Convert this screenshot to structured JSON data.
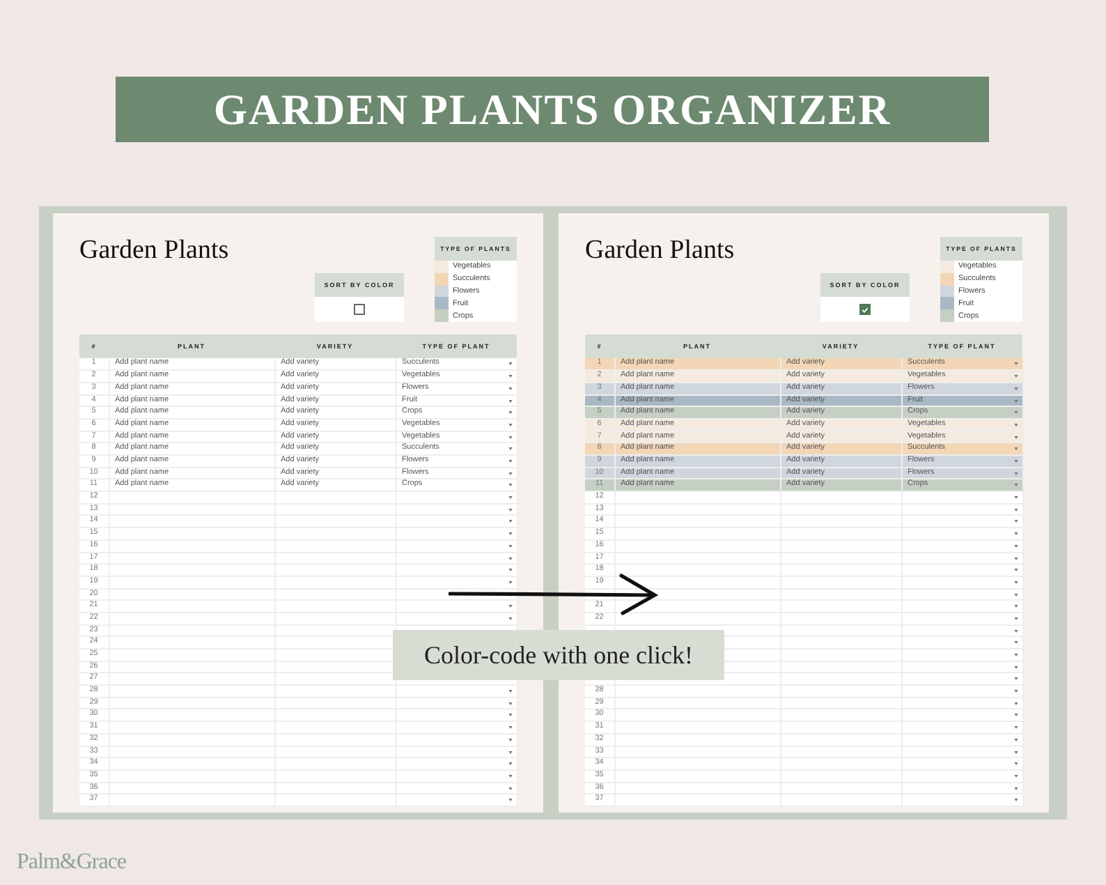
{
  "banner": "GARDEN PLANTS ORGANIZER",
  "sheets": [
    {
      "title": "Garden Plants",
      "sort": {
        "label": "SORT BY COLOR",
        "checked": false
      },
      "legend": {
        "title": "TYPE OF PLANTS",
        "items": [
          {
            "label": "Vegetables",
            "color": "#f4eadf"
          },
          {
            "label": "Succulents",
            "color": "#f2d6b6"
          },
          {
            "label": "Flowers",
            "color": "#cfd6dd"
          },
          {
            "label": "Fruit",
            "color": "#a9b8c5"
          },
          {
            "label": "Crops",
            "color": "#c5cfc4"
          }
        ]
      },
      "columns": [
        "#",
        "PLANT",
        "VARIETY",
        "TYPE OF PLANT"
      ],
      "rows": [
        {
          "num": "1",
          "plant": "Add plant name",
          "variety": "Add variety",
          "type": "Succulents"
        },
        {
          "num": "2",
          "plant": "Add plant name",
          "variety": "Add variety",
          "type": "Vegetables"
        },
        {
          "num": "3",
          "plant": "Add plant name",
          "variety": "Add variety",
          "type": "Flowers"
        },
        {
          "num": "4",
          "plant": "Add plant name",
          "variety": "Add variety",
          "type": "Fruit"
        },
        {
          "num": "5",
          "plant": "Add plant name",
          "variety": "Add variety",
          "type": "Crops"
        },
        {
          "num": "6",
          "plant": "Add plant name",
          "variety": "Add variety",
          "type": "Vegetables"
        },
        {
          "num": "7",
          "plant": "Add plant name",
          "variety": "Add variety",
          "type": "Vegetables"
        },
        {
          "num": "8",
          "plant": "Add plant name",
          "variety": "Add variety",
          "type": "Succulents"
        },
        {
          "num": "9",
          "plant": "Add plant name",
          "variety": "Add variety",
          "type": "Flowers"
        },
        {
          "num": "10",
          "plant": "Add plant name",
          "variety": "Add variety",
          "type": "Flowers"
        },
        {
          "num": "11",
          "plant": "Add plant name",
          "variety": "Add variety",
          "type": "Crops"
        },
        {
          "num": "12"
        },
        {
          "num": "13"
        },
        {
          "num": "14"
        },
        {
          "num": "15"
        },
        {
          "num": "16"
        },
        {
          "num": "17"
        },
        {
          "num": "18"
        },
        {
          "num": "19"
        },
        {
          "num": "20"
        },
        {
          "num": "21"
        },
        {
          "num": "22"
        },
        {
          "num": "23"
        },
        {
          "num": "24"
        },
        {
          "num": "25"
        },
        {
          "num": "26"
        },
        {
          "num": "27"
        },
        {
          "num": "28"
        },
        {
          "num": "29"
        },
        {
          "num": "30"
        },
        {
          "num": "31"
        },
        {
          "num": "32"
        },
        {
          "num": "33"
        },
        {
          "num": "34"
        },
        {
          "num": "35"
        },
        {
          "num": "36"
        },
        {
          "num": "37"
        }
      ]
    },
    {
      "title": "Garden Plants",
      "sort": {
        "label": "SORT BY COLOR",
        "checked": true
      },
      "legend": {
        "title": "TYPE OF PLANTS",
        "items": [
          {
            "label": "Vegetables",
            "color": "#f4eadf"
          },
          {
            "label": "Succulents",
            "color": "#f2d6b6"
          },
          {
            "label": "Flowers",
            "color": "#cfd6dd"
          },
          {
            "label": "Fruit",
            "color": "#a9b8c5"
          },
          {
            "label": "Crops",
            "color": "#c5cfc4"
          }
        ]
      },
      "columns": [
        "#",
        "PLANT",
        "VARIETY",
        "TYPE OF PLANT"
      ],
      "rows": [
        {
          "num": "1",
          "plant": "Add plant name",
          "variety": "Add variety",
          "type": "Succulents",
          "color": "#f2d6b6"
        },
        {
          "num": "2",
          "plant": "Add plant name",
          "variety": "Add variety",
          "type": "Vegetables",
          "color": "#f4eadf"
        },
        {
          "num": "3",
          "plant": "Add plant name",
          "variety": "Add variety",
          "type": "Flowers",
          "color": "#cfd6dd"
        },
        {
          "num": "4",
          "plant": "Add plant name",
          "variety": "Add variety",
          "type": "Fruit",
          "color": "#a9b8c5"
        },
        {
          "num": "5",
          "plant": "Add plant name",
          "variety": "Add variety",
          "type": "Crops",
          "color": "#c5cfc4"
        },
        {
          "num": "6",
          "plant": "Add plant name",
          "variety": "Add variety",
          "type": "Vegetables",
          "color": "#f4eadf"
        },
        {
          "num": "7",
          "plant": "Add plant name",
          "variety": "Add variety",
          "type": "Vegetables",
          "color": "#f4eadf"
        },
        {
          "num": "8",
          "plant": "Add plant name",
          "variety": "Add variety",
          "type": "Succulents",
          "color": "#f2d6b6"
        },
        {
          "num": "9",
          "plant": "Add plant name",
          "variety": "Add variety",
          "type": "Flowers",
          "color": "#cfd6dd"
        },
        {
          "num": "10",
          "plant": "Add plant name",
          "variety": "Add variety",
          "type": "Flowers",
          "color": "#cfd6dd"
        },
        {
          "num": "11",
          "plant": "Add plant name",
          "variety": "Add variety",
          "type": "Crops",
          "color": "#c5cfc4"
        },
        {
          "num": "12"
        },
        {
          "num": "13"
        },
        {
          "num": "14"
        },
        {
          "num": "15"
        },
        {
          "num": "16"
        },
        {
          "num": "17"
        },
        {
          "num": "18"
        },
        {
          "num": "19"
        },
        {},
        {
          "num": "21"
        },
        {
          "num": "22"
        },
        {},
        {},
        {},
        {},
        {},
        {
          "num": "28"
        },
        {
          "num": "29"
        },
        {
          "num": "30"
        },
        {
          "num": "31"
        },
        {
          "num": "32"
        },
        {
          "num": "33"
        },
        {
          "num": "34"
        },
        {
          "num": "35"
        },
        {
          "num": "36"
        },
        {
          "num": "37"
        }
      ]
    }
  ],
  "callout": "Color-code with one click!",
  "brand": "Palm&Grace"
}
